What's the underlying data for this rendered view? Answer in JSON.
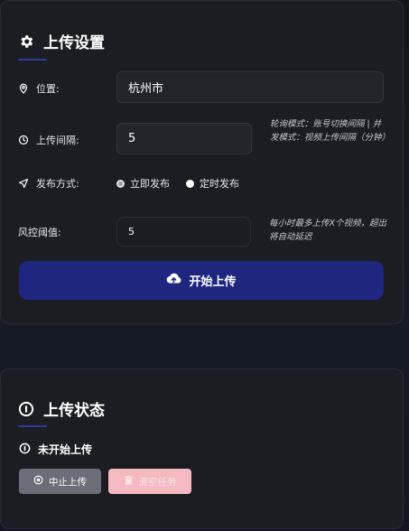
{
  "upload_settings": {
    "title": "上传设置",
    "title_icon": "gear-icon",
    "location": {
      "label": "位置:",
      "icon": "map-pin-icon",
      "value": "杭州市"
    },
    "interval": {
      "label": "上传间隔:",
      "icon": "clock-icon",
      "value": "5",
      "hint": "轮询模式：账号切换间隔 | 并发模式：视频上传间隔（分钟）"
    },
    "publish_mode": {
      "label": "发布方式:",
      "icon": "send-icon",
      "options": [
        {
          "label": "立即发布",
          "selected": true
        },
        {
          "label": "定时发布",
          "selected": false
        }
      ]
    },
    "risk_threshold": {
      "label": "风控阈值:",
      "value": "5",
      "hint": "每小时最多上传X个视频，超出将自动延迟"
    },
    "start_button": {
      "label": "开始上传",
      "icon": "cloud-upload-icon"
    }
  },
  "upload_status": {
    "title": "上传状态",
    "title_icon": "info-icon",
    "status_text": "未开始上传",
    "status_icon": "info-icon",
    "stop_button": {
      "label": "中止上传",
      "icon": "stop-circle-icon"
    },
    "clear_button": {
      "label": "清空任务",
      "icon": "trash-icon"
    }
  },
  "colors": {
    "primary": "#1f2680",
    "stop_button": "#6b6e78",
    "clear_button": "#f4b9c1",
    "accent_underline": "#2b3a9a"
  }
}
